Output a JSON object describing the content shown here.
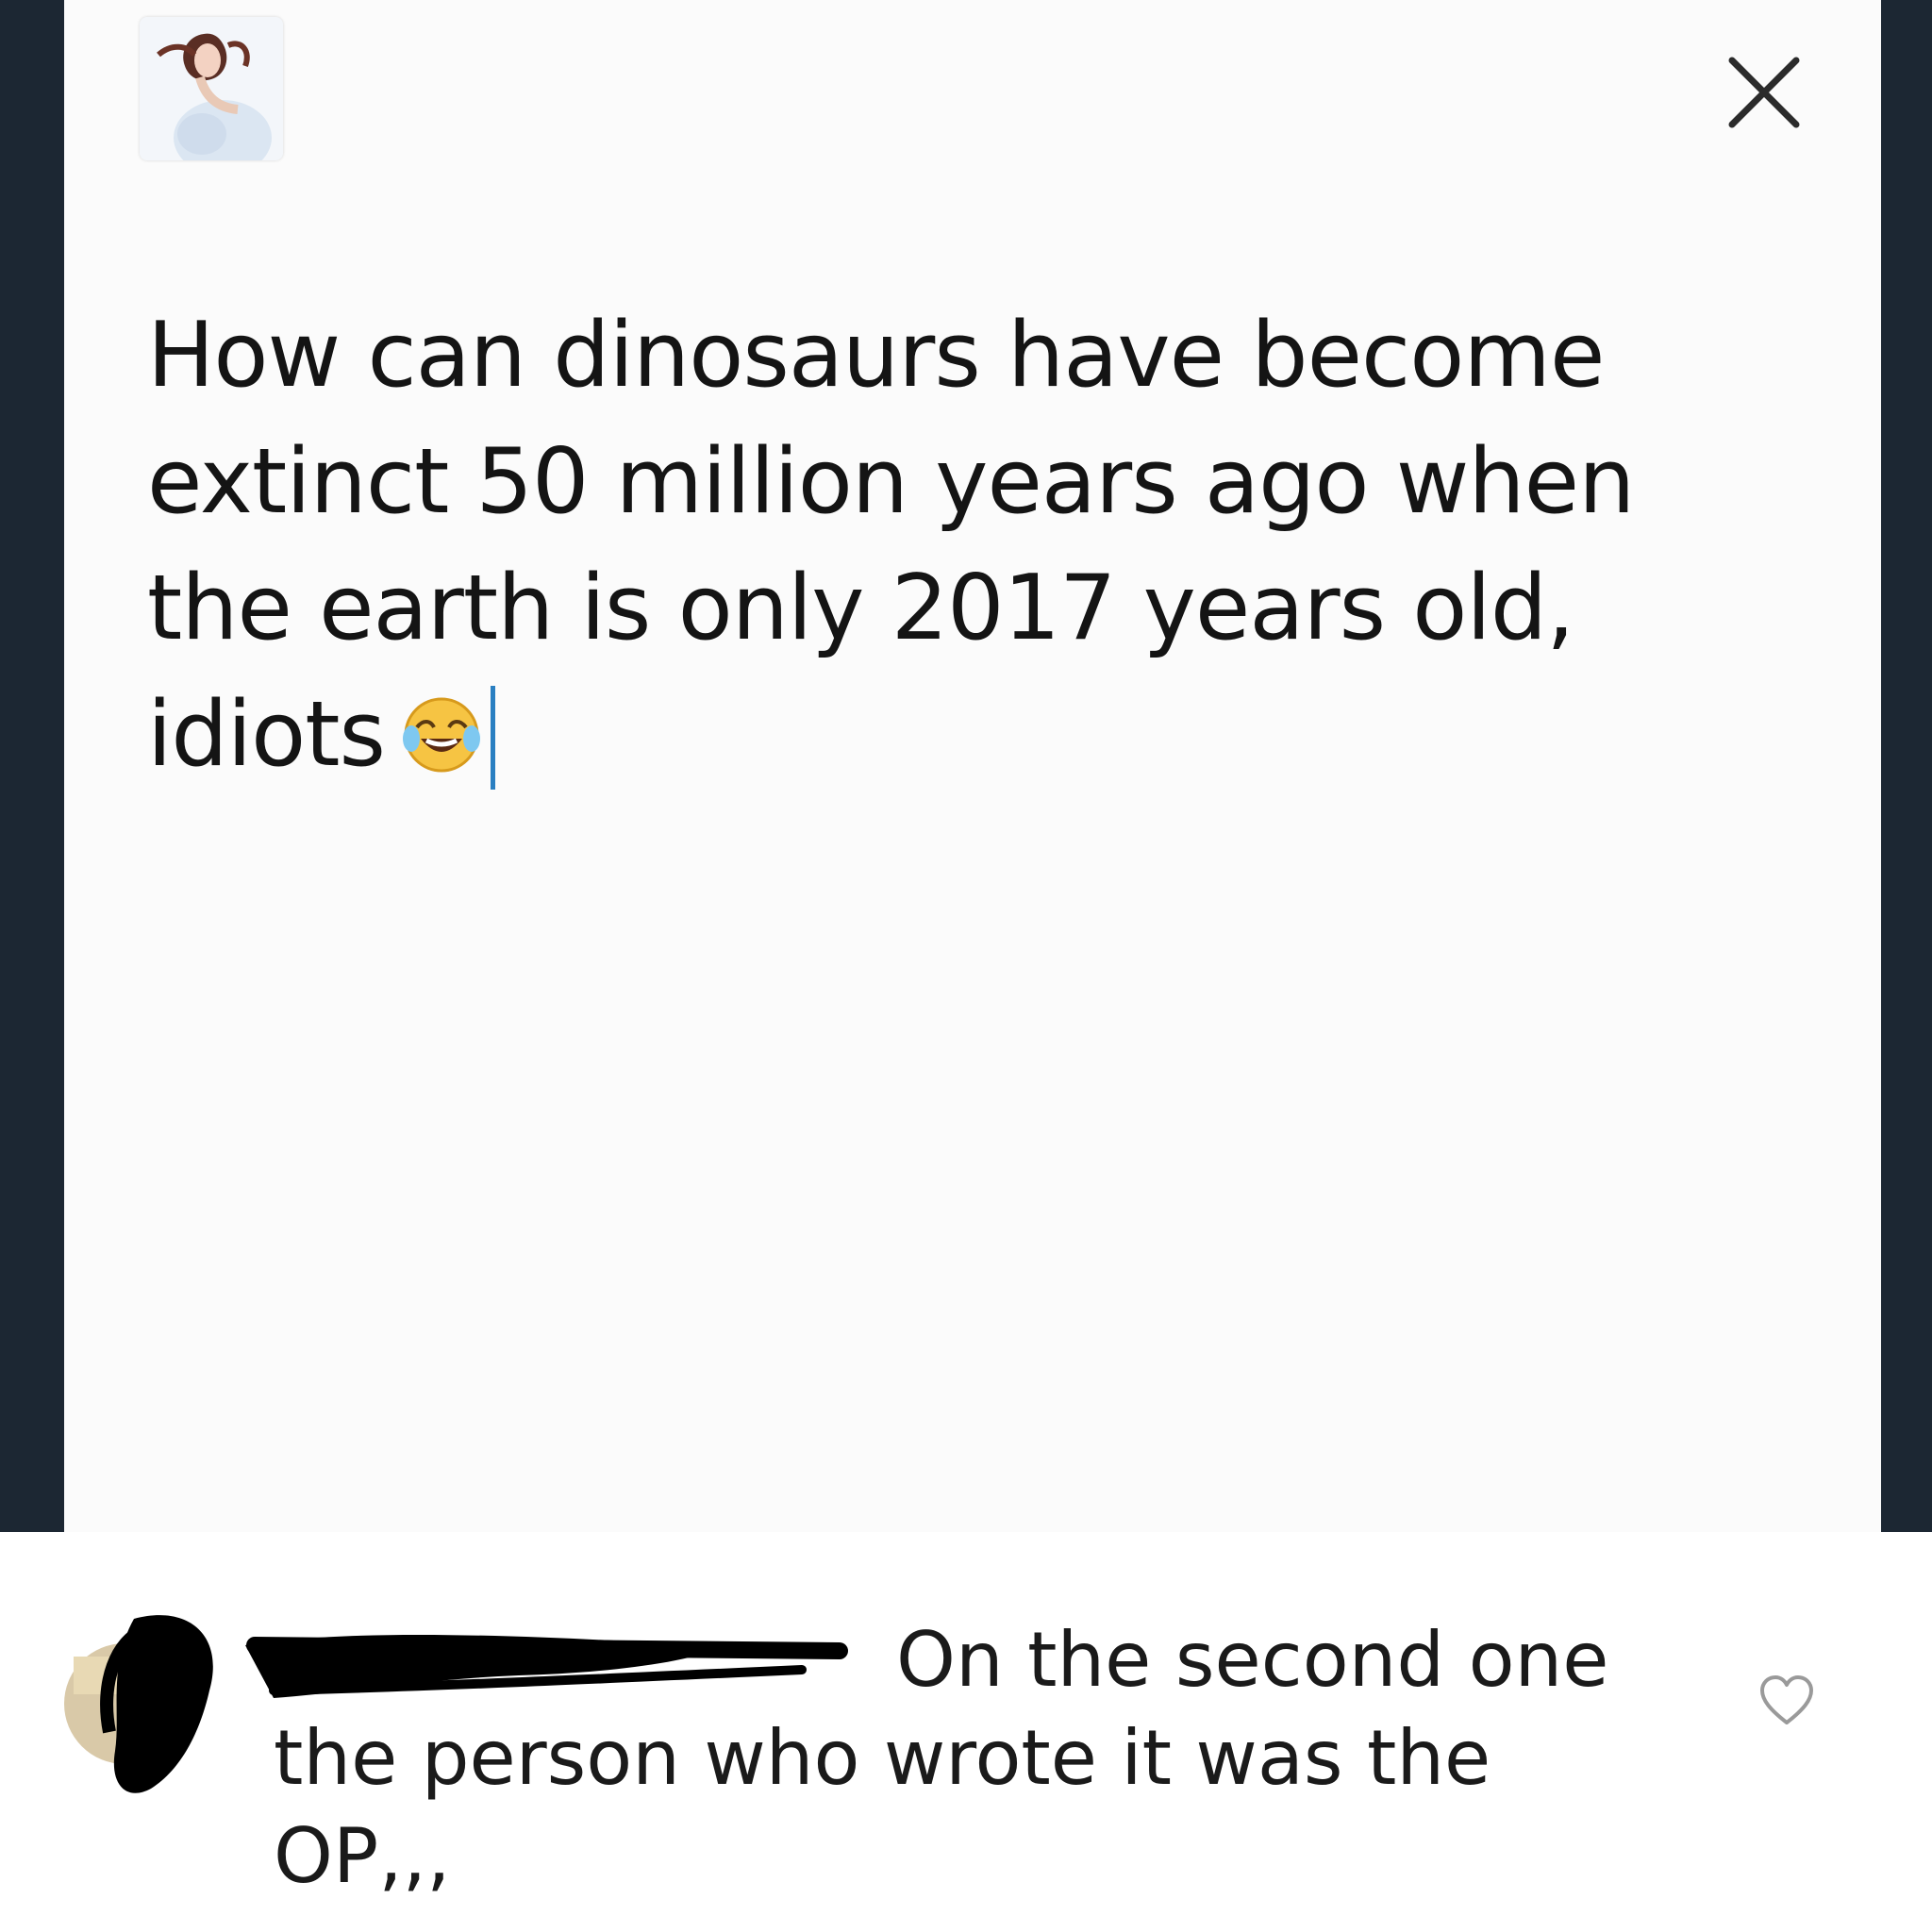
{
  "compose": {
    "text": "How can dinosaurs have become\nextinct 50 million years ago when\nthe earth is only 2017 years old,\nidiots",
    "emoji": "face-with-tears-of-joy"
  },
  "icons": {
    "close": "close-icon",
    "like": "heart-icon"
  },
  "comment": {
    "text": "On the second one\nthe person who wrote it was the\nOP,,,"
  },
  "colors": {
    "frame": "#1c2733",
    "panel": "#fbfbfb",
    "text": "#141414",
    "cursor": "#2a7fc1"
  }
}
